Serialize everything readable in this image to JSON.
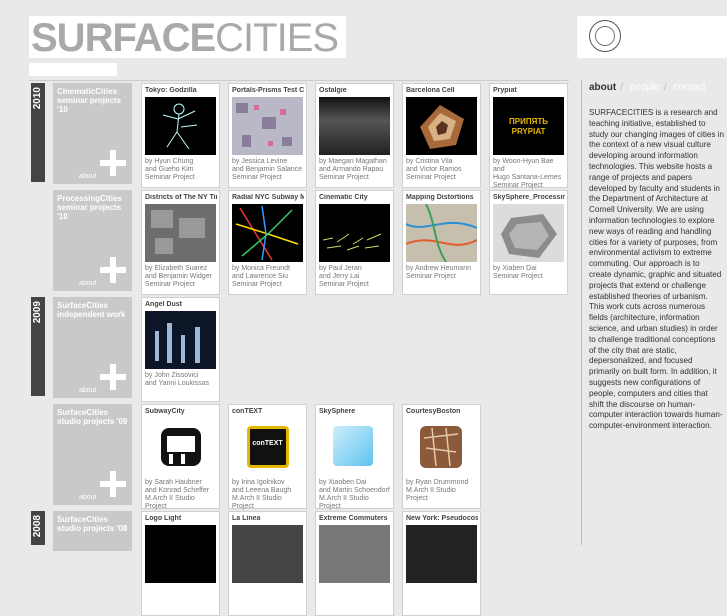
{
  "logo": {
    "bold": "SURFACE",
    "light": "CITIES"
  },
  "nav": {
    "items": [
      "about",
      "people",
      "contact"
    ],
    "sep": "/"
  },
  "about_text": "SURFACECITIES is a research and teaching initiative, established to study our changing images of cities in the context of a new visual culture developing around information technologies. This website hosts a range of projects and papers developed by faculty and students in the Department of Architecture at Cornell University. We are using information technologies to explore new ways of reading and handling cities for a variety of purposes, from environmental activism to extreme commuting. Our approach is to create dynamic, graphic and situated projects that extend or challenge established theories of urbanism. This work cuts across numerous fields (architecture, information science, and urban studies) in order to challenge traditional conceptions of the city that are static, depersonalized, and focused primarily on built form. In addition, it suggests new configurations of people, computers and cities that shift the discourse on human-computer interaction towards human-computer-environment interaction.",
  "years": [
    "2010",
    "2009",
    "2008"
  ],
  "categories": [
    {
      "title": "CinematicCities\nseminar projects '10",
      "about": "about"
    },
    {
      "title": "ProcessingCities\nseminar projects '10",
      "about": "about"
    },
    {
      "title": "SurfaceCities\nindependent work",
      "about": "about"
    },
    {
      "title": "SurfaceCities\nstudio projects '09",
      "about": "about"
    },
    {
      "title": "SurfaceCities\nstudio projects '08",
      "about": "about"
    }
  ],
  "cards": [
    {
      "title": "Tokyo: Godzilla",
      "by": "by Hyun Chung\nand Gueho Kim\nSeminar Project"
    },
    {
      "title": "Portals-Prisms Test Cities",
      "by": "by Jessica Levine\nand Benjamin Salance\nSeminar Project"
    },
    {
      "title": "Ostalgie",
      "by": "by Maegan Magathan\nand Armando Rapau\nSeminar Project"
    },
    {
      "title": "Barcelona Cell",
      "by": "by Cristina Vila\nand Victor Ramos\nSeminar Project"
    },
    {
      "title": "Prypiat",
      "by": "by Woon-Hyun Bae and\nHugo Santana-Lemes\nSeminar Project"
    },
    {
      "title": "Districts of The NY Times",
      "by": "by Elizabeth Suarez\nand Benjamin Widger\nSeminar Project"
    },
    {
      "title": "Radial NYC Subway Map",
      "by": "by Monica Freundt\nand Lawrence Siu\nSeminar Project"
    },
    {
      "title": "Cinematic City",
      "by": "by Paul Jeran\nand Jerry Lai\nSeminar Project"
    },
    {
      "title": "Mapping Distortions",
      "by": "by Andrew Heumann\nSeminar Project"
    },
    {
      "title": "SkySphere_Processing",
      "by": "by Xiaben Dai\nSeminar Project"
    },
    {
      "title": "Angel Dust",
      "by": "by John Zissovici\nand Yanni Loukissas"
    },
    {
      "title": "SubwayCity",
      "by": "by Sarah Haubner\nand Konrad Scheffer\nM.Arch II Studio Project"
    },
    {
      "title": "conTEXT",
      "by": "by Irina Igolnikov\nand Leeena Baugh\nM.Arch II Studio Project"
    },
    {
      "title": "SkySphere",
      "by": "by Xiaoben Dai\nand Martin Schoendorf\nM.Arch II Studio Project"
    },
    {
      "title": "CourtesyBoston",
      "by": "by Ryan Drummond\nM.Arch II Studio Project"
    },
    {
      "title": "Logo Light",
      "by": ""
    },
    {
      "title": "La Linea",
      "by": ""
    },
    {
      "title": "Extreme Commuters",
      "by": ""
    },
    {
      "title": "New York: Pseudocosm",
      "by": ""
    }
  ],
  "image_text": {
    "prypiat": "ПРИПЯТЬ\nPRYPIAT",
    "context": "conTEXT"
  },
  "colors": {
    "year_bar": "#444444",
    "category_box": "#c9c9c9",
    "background": "#e9e9e9"
  }
}
